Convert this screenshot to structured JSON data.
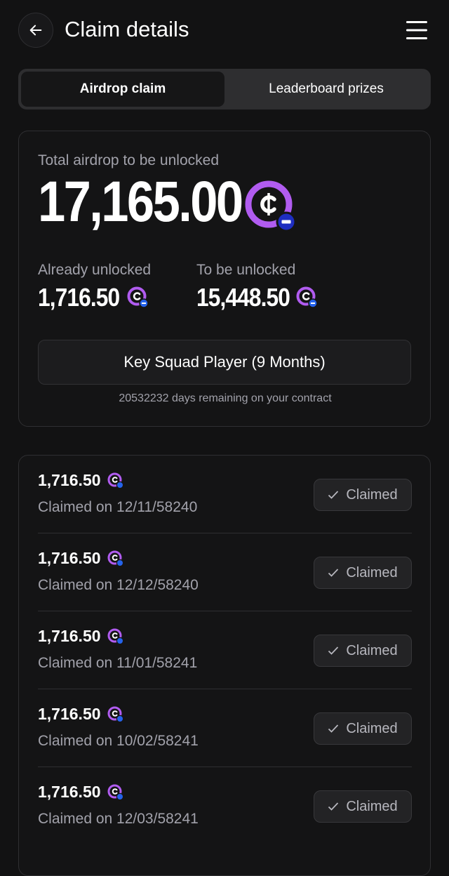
{
  "header": {
    "title": "Claim details",
    "back_icon": "arrow-left-icon",
    "menu_icon": "hamburger-menu-icon"
  },
  "tabs": [
    {
      "label": "Airdrop claim",
      "active": true
    },
    {
      "label": "Leaderboard prizes",
      "active": false
    }
  ],
  "summary": {
    "total_label": "Total airdrop to be unlocked",
    "total_amount": "17,165.00",
    "unlocked_label": "Already unlocked",
    "unlocked_amount": "1,716.50",
    "to_unlock_label": "To be unlocked",
    "to_unlock_amount": "15,448.50",
    "player_button": "Key Squad Player (9 Months)",
    "contract_note": "20532232 days remaining on your contract"
  },
  "claims": [
    {
      "amount": "1,716.50",
      "date": "Claimed on 12/11/58240",
      "status": "Claimed"
    },
    {
      "amount": "1,716.50",
      "date": "Claimed on 12/12/58240",
      "status": "Claimed"
    },
    {
      "amount": "1,716.50",
      "date": "Claimed on 11/01/58241",
      "status": "Claimed"
    },
    {
      "amount": "1,716.50",
      "date": "Claimed on 10/02/58241",
      "status": "Claimed"
    },
    {
      "amount": "1,716.50",
      "date": "Claimed on 12/03/58241",
      "status": "Claimed"
    }
  ],
  "colors": {
    "background": "#121213",
    "coin_purple": "#b15cf0",
    "coin_badge_blue": "#2563eb",
    "muted_text": "#a2a2ab"
  }
}
